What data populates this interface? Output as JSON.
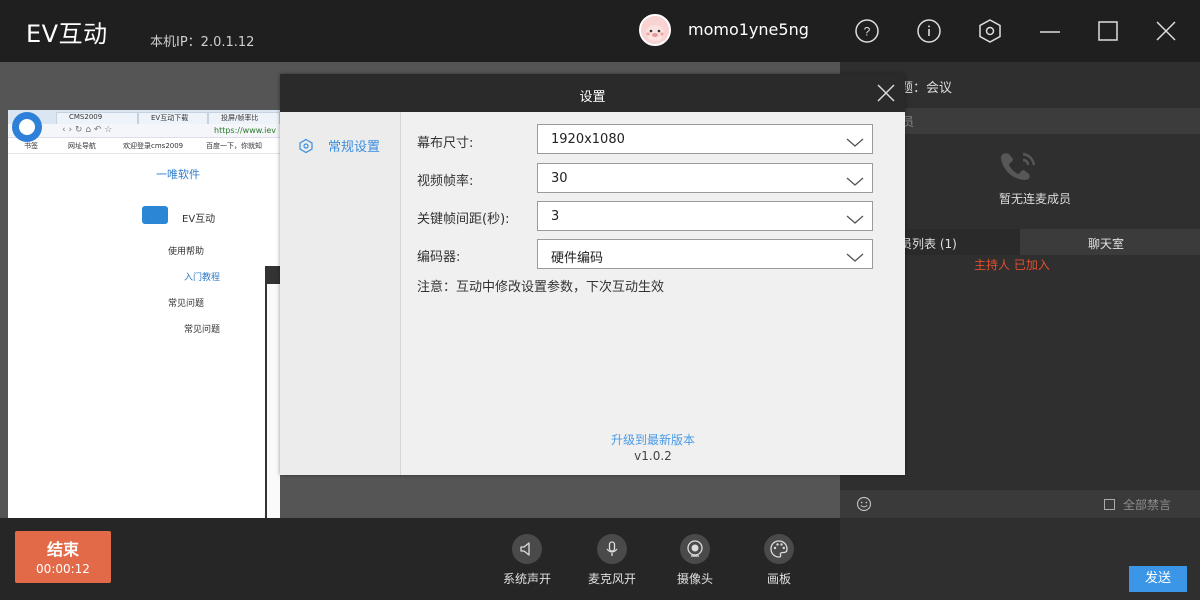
{
  "titlebar": {
    "app_title": "EV互动",
    "ip_label": "本机IP：2.0.1.12",
    "username": "momo1yne5ng",
    "icons": [
      "help-icon",
      "info-icon",
      "settings-hex-icon",
      "minimize-icon",
      "maximize-icon",
      "close-icon"
    ]
  },
  "shared_screen": {
    "tabs": [
      "CMS2009",
      "EV互动下载",
      "投屏/帧率比"
    ],
    "address": "https://www.iev",
    "favorites": [
      "书签",
      "网址导航",
      "欢迎登录cms2009",
      "百度一下，你就知"
    ],
    "brand": "一唯软件",
    "product": "EV互动",
    "menu": [
      "使用帮助",
      "入门教程",
      "常见问题",
      "常见问题"
    ]
  },
  "dialog": {
    "title": "设置",
    "nav": {
      "general": "常规设置"
    },
    "fields": [
      {
        "label": "幕布尺寸:",
        "value": "1920x1080"
      },
      {
        "label": "视频帧率:",
        "value": "30"
      },
      {
        "label": "关键帧间距(秒):",
        "value": "3"
      },
      {
        "label": "编码器:",
        "value": "硬件编码"
      }
    ],
    "note": "注意：互动中修改设置参数，下次互动生效",
    "upgrade": "升级到最新版本",
    "version": "v1.0.2"
  },
  "right_panel": {
    "room_title": "题：会议",
    "sub_bar": "员",
    "empty_text": "暂无连麦成员",
    "tab_members": "员列表 (1)",
    "tab_chat": "聊天室",
    "member_line": "主持人  已加入",
    "mute_all": "全部禁言",
    "send": "发送"
  },
  "bottom": {
    "end_label": "结束",
    "timer": "00:00:12",
    "controls": [
      {
        "label": "系统声开",
        "icon": "speaker-icon"
      },
      {
        "label": "麦克风开",
        "icon": "microphone-icon"
      },
      {
        "label": "摄像头",
        "icon": "camera-icon"
      },
      {
        "label": "画板",
        "icon": "palette-icon"
      }
    ]
  }
}
